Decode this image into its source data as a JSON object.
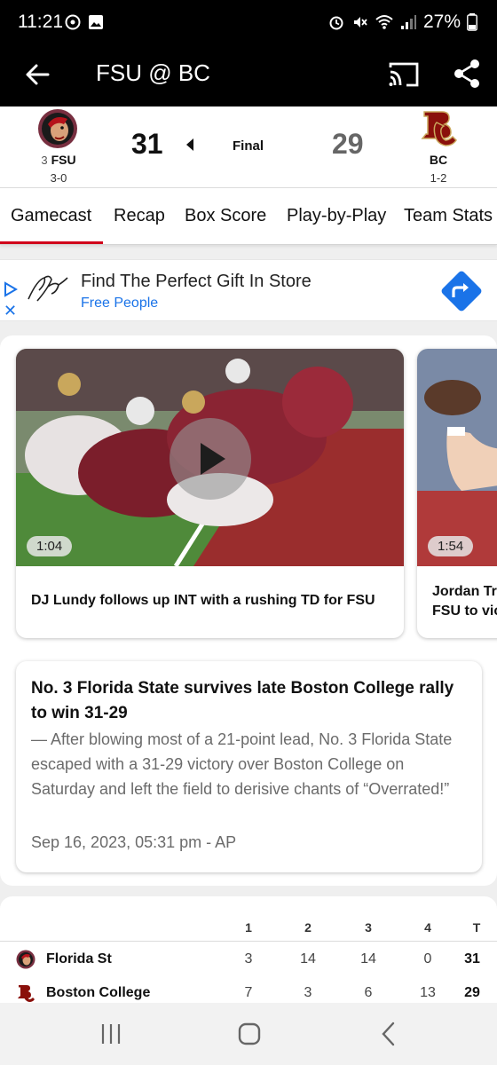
{
  "status_bar": {
    "time": "11:21",
    "battery": "27%"
  },
  "app_bar": {
    "title": "FSU @ BC"
  },
  "scoreboard": {
    "home": {
      "rank": "3",
      "abbr": "FSU",
      "record": "3-0",
      "score": "31"
    },
    "away": {
      "abbr": "BC",
      "record": "1-2",
      "score": "29"
    },
    "status": "Final"
  },
  "tabs": [
    {
      "label": "Gamecast"
    },
    {
      "label": "Recap"
    },
    {
      "label": "Box Score"
    },
    {
      "label": "Play-by-Play"
    },
    {
      "label": "Team Stats"
    }
  ],
  "ad": {
    "headline": "Find The Perfect Gift In Store",
    "advertiser": "Free People"
  },
  "videos": [
    {
      "duration": "1:04",
      "title": "DJ Lundy follows up INT with a rushing TD for FSU"
    },
    {
      "duration": "1:54",
      "title": "Jordan Tr\nFSU to vic"
    }
  ],
  "article": {
    "headline": "No. 3 Florida State survives late Boston College rally to win 31-29",
    "summary": "— After blowing most of a 21-point lead, No. 3 Florida State escaped with a 31-29 victory over Boston College on Saturday and left the field to derisive chants of “Overrated!”",
    "meta": "Sep 16, 2023, 05:31 pm - AP"
  },
  "linescore": {
    "headers": [
      "1",
      "2",
      "3",
      "4",
      "T"
    ],
    "rows": [
      {
        "team": "Florida St",
        "scores": [
          "3",
          "14",
          "14",
          "0"
        ],
        "total": "31"
      },
      {
        "team": "Boston College",
        "scores": [
          "7",
          "3",
          "6",
          "13"
        ],
        "total": "29"
      }
    ]
  },
  "colors": {
    "accent": "#d0021b",
    "fsu_garnet": "#782f40",
    "bc_maroon": "#8a100b",
    "ad_blue": "#1a73e8"
  }
}
